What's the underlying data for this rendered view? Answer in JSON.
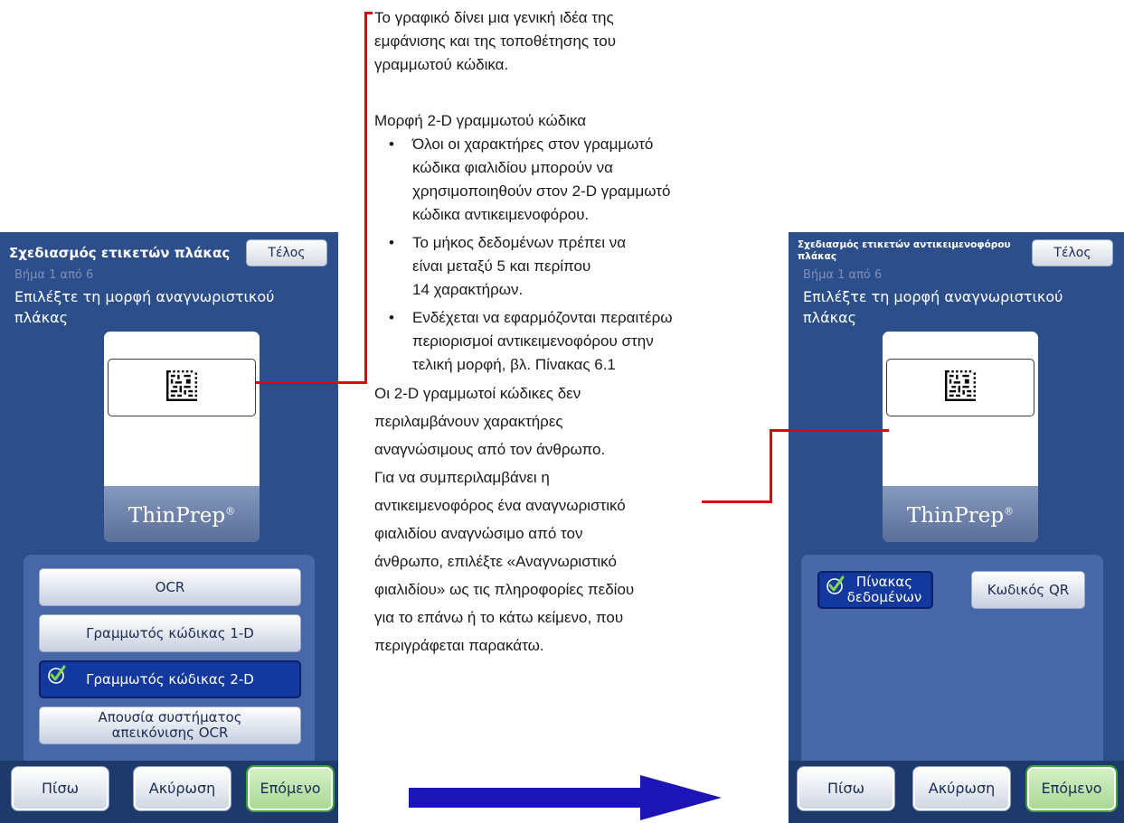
{
  "left_screen": {
    "title": "Σχεδιασμός ετικετών πλάκας",
    "done_label": "Τέλος",
    "step": "Βήμα 1 από 6",
    "prompt": "Επιλέξτε τη μορφή αναγνωριστικού πλάκας",
    "brand": "ThinPrep",
    "brand_mark": "®",
    "options": [
      "OCR",
      "Γραμμωτός κώδικας 1-D",
      "Γραμμωτός κώδικας 2-D",
      "Απουσία συστήματος απεικόνισης OCR"
    ],
    "selected_option": "Γραμμωτός κώδικας 2-D",
    "back_label": "Πίσω",
    "cancel_label": "Ακύρωση",
    "next_label": "Επόμενο"
  },
  "right_screen": {
    "title": "Σχεδιασμός ετικετών αντικειμενοφόρου πλάκας",
    "done_label": "Τέλος",
    "step": "Βήμα 1 από 6",
    "prompt": "Επιλέξτε τη μορφή αναγνωριστικού πλάκας",
    "brand": "ThinPrep",
    "brand_mark": "®",
    "options": [
      "Πίνακας δεδομένων",
      "Κωδικός QR"
    ],
    "selected_option": "Πίνακας δεδομένων",
    "back_label": "Πίσω",
    "cancel_label": "Ακύρωση",
    "next_label": "Επόμενο"
  },
  "annotation": {
    "intro_lines": [
      "Το γραφικό δίνει μια γενική ιδέα της",
      "εμφάνισης και της τοποθέτησης του",
      "γραμμωτού κώδικα."
    ],
    "heading": "Μορφή 2-D γραμμωτού κώδικα",
    "bullet1": [
      "Όλοι οι χαρακτήρες στον γραμμωτό",
      "κώδικα φιαλιδίου μπορούν να",
      "χρησιμοποιηθούν στον 2-D γραμμωτό",
      "κώδικα αντικειμενοφόρου."
    ],
    "bullet2": [
      "Το μήκος δεδομένων πρέπει να",
      "είναι μεταξύ 5 και περίπου",
      "14 χαρακτήρων."
    ],
    "bullet3": [
      "Ενδέχεται να εφαρμόζονται περαιτέρω",
      "περιορισμοί αντικειμενοφόρου στην",
      "τελική μορφή, βλ. Πίνακας 6.1"
    ],
    "bullet_char": "•",
    "closing_lines": [
      "Οι 2-D γραμμωτοί κώδικες δεν",
      "περιλαμβάνουν χαρακτήρες",
      "αναγνώσιμους από τον άνθρωπο.",
      "Για να συμπεριλαμβάνει η",
      "αντικειμενοφόρος ένα αναγνωριστικό",
      "φιαλιδίου αναγνώσιμο από τον",
      "άνθρωπο, επιλέξτε «Αναγνωριστικό",
      "φιαλιδίου» ως τις πληροφορίες πεδίου",
      "για το επάνω ή το κάτω κείμενο, που",
      "περιγράφεται παρακάτω."
    ]
  },
  "colors": {
    "panel_bg": "#2c4f8c",
    "options_bg": "#4867a8",
    "selected_bg": "#14399e",
    "connector": "#e3000f",
    "arrow": "#1d14b8",
    "next_border": "#3fa33a"
  }
}
